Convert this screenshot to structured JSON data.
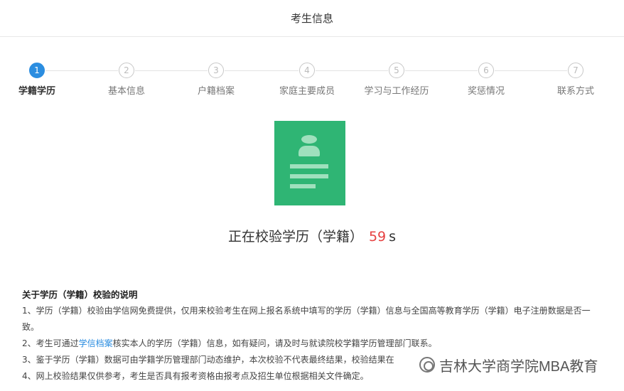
{
  "header": {
    "title": "考生信息"
  },
  "steps": [
    {
      "num": "1",
      "label": "学籍学历"
    },
    {
      "num": "2",
      "label": "基本信息"
    },
    {
      "num": "3",
      "label": "户籍档案"
    },
    {
      "num": "4",
      "label": "家庭主要成员"
    },
    {
      "num": "5",
      "label": "学习与工作经历"
    },
    {
      "num": "6",
      "label": "奖惩情况"
    },
    {
      "num": "7",
      "label": "联系方式"
    }
  ],
  "active_step": 1,
  "verify": {
    "icon": "student-card-icon",
    "status_text": "正在校验学历（学籍）",
    "countdown": "59",
    "unit": "s",
    "accent_color": "#2fb574",
    "countdown_color": "#e64141"
  },
  "notes": {
    "title": "关于学历（学籍）校验的说明",
    "item1": "1、学历（学籍）校验由学信网免费提供，仅用来校验考生在网上报名系统中填写的学历（学籍）信息与全国高等教育学历（学籍）电子注册数据是否一致。",
    "item2_pre": "2、考生可通过",
    "item2_link": "学信档案",
    "item2_post": "核实本人的学历（学籍）信息，如有疑问，请及时与就读院校学籍学历管理部门联系。",
    "item3": "3、鉴于学历（学籍）数据可由学籍学历管理部门动态维护，本次校验不代表最终结果，校验结果在",
    "item4": "4、网上校验结果仅供参考，考生是否具有报考资格由报考点及招生单位根据相关文件确定。"
  },
  "watermark": {
    "text": "吉林大学商学院MBA教育"
  }
}
